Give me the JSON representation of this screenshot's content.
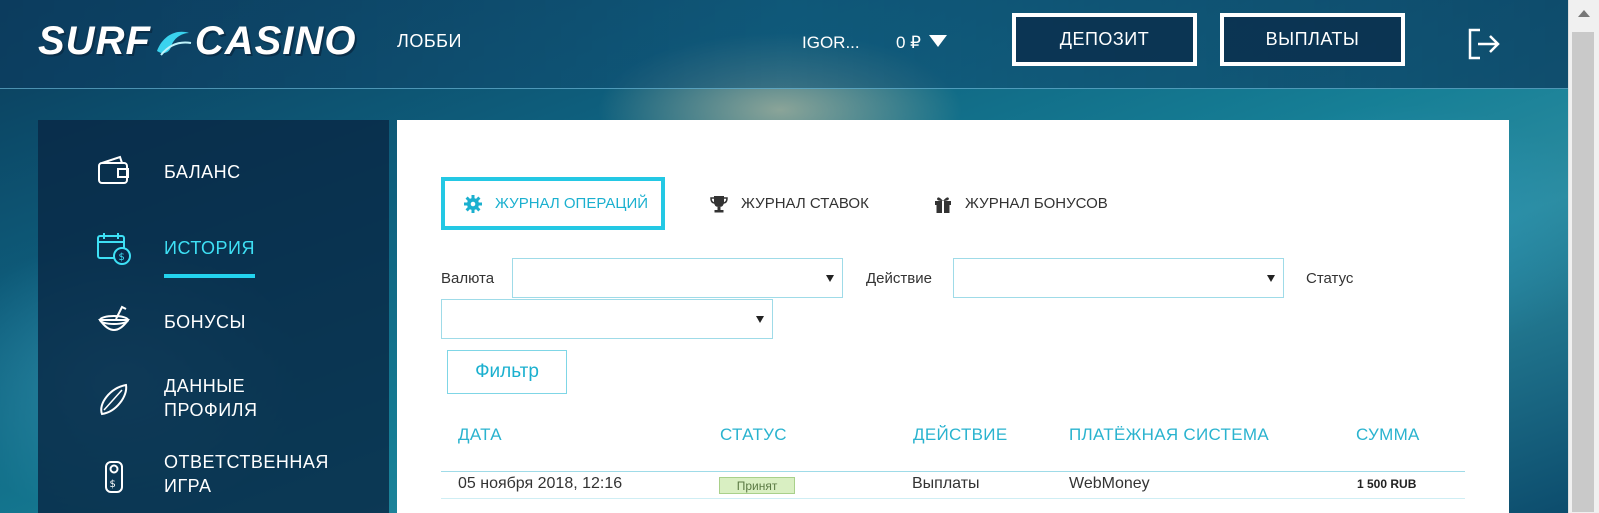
{
  "header": {
    "logo_left": "SURF",
    "logo_right": "CASINO",
    "nav_lobby": "ЛОББИ",
    "user_name": "IGOR...",
    "balance": "0 ₽",
    "deposit_label": "ДЕПОЗИТ",
    "payout_label": "ВЫПЛАТЫ"
  },
  "sidebar": {
    "items": [
      {
        "label": "БАЛАНС",
        "icon": "wallet-icon"
      },
      {
        "label": "ИСТОРИЯ",
        "icon": "calendar-money-icon",
        "active": true
      },
      {
        "label": "БОНУСЫ",
        "icon": "coconut-drink-icon"
      },
      {
        "label_line1": "ДАННЫЕ",
        "label_line2": "ПРОФИЛЯ",
        "icon": "surfboard-icon"
      },
      {
        "label_line1": "ОТВЕТСТВЕННАЯ",
        "label_line2": "ИГРА",
        "icon": "door-hanger-icon"
      }
    ]
  },
  "tabs": [
    {
      "label": "ЖУРНАЛ ОПЕРАЦИЙ",
      "icon": "gear-icon",
      "active": true
    },
    {
      "label": "ЖУРНАЛ СТАВОК",
      "icon": "trophy-icon"
    },
    {
      "label": "ЖУРНАЛ БОНУСОВ",
      "icon": "gift-icon"
    }
  ],
  "filters": {
    "currency_label": "Валюта",
    "currency_value": "",
    "action_label": "Действие",
    "action_value": "",
    "status_label": "Статус",
    "status_value": "",
    "filter_button": "Фильтр"
  },
  "table": {
    "columns": [
      "ДАТА",
      "СТАТУС",
      "ДЕЙСТВИЕ",
      "ПЛАТЁЖНАЯ СИСТЕМА",
      "СУММА"
    ],
    "rows": [
      {
        "date": "05 ноября 2018, 12:16",
        "status": "Принят",
        "action": "Выплаты",
        "system": "WebMoney",
        "amount": "1 500 RUB"
      }
    ]
  },
  "colors": {
    "accent": "#23c8e4",
    "sidebar_bg": "#09284a",
    "status_ok": "#d9efc2"
  }
}
